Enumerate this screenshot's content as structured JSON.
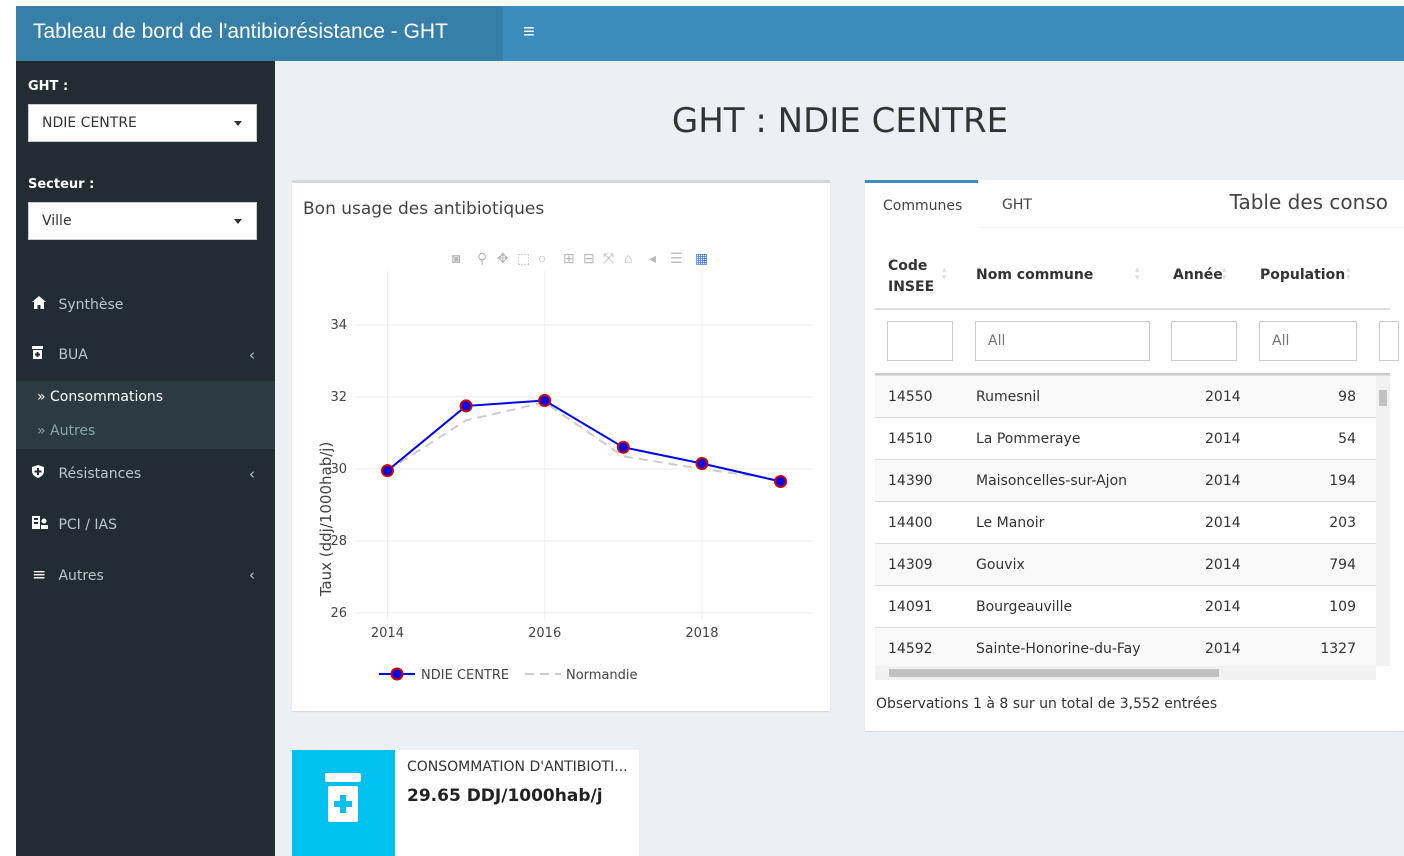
{
  "header": {
    "title": "Tableau de bord de l'antibiorésistance - GHT",
    "toggle_icon": "hamburger-icon"
  },
  "sidebar": {
    "ght_label": "GHT :",
    "ght_value": "NDIE CENTRE",
    "secteur_label": "Secteur :",
    "secteur_value": "Ville",
    "items": [
      {
        "label": "Synthèse",
        "icon": "home-icon"
      },
      {
        "label": "BUA",
        "icon": "pill-bottle-icon"
      },
      {
        "label": "Résistances",
        "icon": "shield-icon"
      },
      {
        "label": "PCI / IAS",
        "icon": "users-icon"
      },
      {
        "label": "Autres",
        "icon": "bars-icon"
      }
    ],
    "subitems": [
      {
        "label": "Consommations"
      },
      {
        "label": "Autres"
      }
    ]
  },
  "main": {
    "title": "GHT : NDIE CENTRE"
  },
  "chart_box": {
    "title": "Bon usage des antibiotiques",
    "modebar_icons": [
      "camera-icon",
      "zoom-icon",
      "pan-icon",
      "box-select-icon",
      "lasso-icon",
      "zoom-in-icon",
      "zoom-out-icon",
      "autoscale-icon",
      "reset-axes-icon",
      "spike-lines-icon",
      "hover-compare-icon",
      "plotly-logo-icon"
    ]
  },
  "chart_data": {
    "type": "line",
    "title": "",
    "xlabel": "",
    "ylabel": "Taux (ddj/1000hab/j)",
    "x": [
      2014,
      2015,
      2016,
      2017,
      2018,
      2019
    ],
    "xticks": [
      "2014",
      "2016",
      "2018"
    ],
    "yticks": [
      "26",
      "28",
      "30",
      "32",
      "34"
    ],
    "xlim": [
      2013.6,
      2019.4
    ],
    "ylim": [
      25.8,
      35.5
    ],
    "grid": true,
    "legend_position": "bottom",
    "series": [
      {
        "name": "NDIE CENTRE",
        "values": [
          29.95,
          31.75,
          31.9,
          30.6,
          30.15,
          29.65
        ],
        "color": "#0000ee",
        "marker_color": "#cc0000",
        "dash": "solid"
      },
      {
        "name": "Normandie",
        "values": [
          29.95,
          31.35,
          31.85,
          30.35,
          30.0,
          29.7
        ],
        "color": "#cccccc",
        "dash": "dash"
      }
    ]
  },
  "table_box": {
    "tabs": [
      "Communes",
      "GHT"
    ],
    "header": "Table des conso",
    "columns": [
      "Code INSEE",
      "Nom commune",
      "Année",
      "Population"
    ],
    "filter_placeholders": [
      "",
      "All",
      "",
      "All"
    ],
    "rows": [
      [
        "14550",
        "Rumesnil",
        "2014",
        "98"
      ],
      [
        "14510",
        "La Pommeraye",
        "2014",
        "54"
      ],
      [
        "14390",
        "Maisoncelles-sur-Ajon",
        "2014",
        "194"
      ],
      [
        "14400",
        "Le Manoir",
        "2014",
        "203"
      ],
      [
        "14309",
        "Gouvix",
        "2014",
        "794"
      ],
      [
        "14091",
        "Bourgeauville",
        "2014",
        "109"
      ],
      [
        "14592",
        "Sainte-Honorine-du-Fay",
        "2014",
        "1327"
      ]
    ],
    "info": "Observations 1 à 8 sur un total de 3,552 entrées"
  },
  "infobox": {
    "text": "CONSOMMATION D'ANTIBIOTI...",
    "number": "29.65 DDJ/1000hab/j",
    "icon": "prescription-bottle-icon",
    "color": "#00c0ef"
  },
  "colors": {
    "header": "#3c8dbc",
    "brand": "#367fa9",
    "sidebar": "#222d32",
    "background": "#ecf0f5"
  }
}
